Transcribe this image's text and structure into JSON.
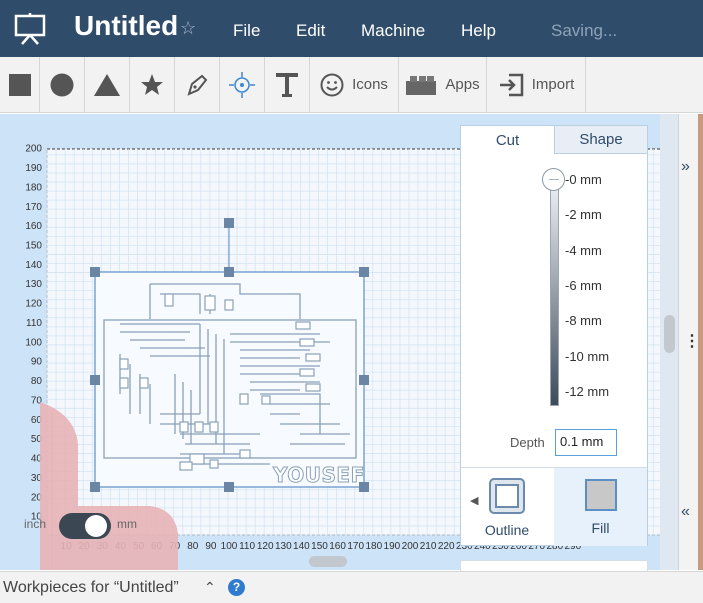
{
  "header": {
    "title": "Untitled",
    "menu": [
      "File",
      "Edit",
      "Machine",
      "Help"
    ],
    "status": "Saving..."
  },
  "toolbar": {
    "icons_label": "Icons",
    "apps_label": "Apps",
    "import_label": "Import"
  },
  "canvas": {
    "y_ticks": [
      "200",
      "190",
      "180",
      "170",
      "160",
      "150",
      "140",
      "130",
      "120",
      "110",
      "100",
      "90",
      "80",
      "70",
      "60",
      "50",
      "40",
      "30",
      "20",
      "10"
    ],
    "x_ticks": [
      "10",
      "20",
      "30",
      "40",
      "50",
      "60",
      "70",
      "80",
      "90",
      "100",
      "110",
      "120",
      "130",
      "140",
      "150",
      "160",
      "170",
      "180",
      "190",
      "200",
      "210",
      "220",
      "230",
      "240",
      "250",
      "260",
      "270",
      "280",
      "290"
    ],
    "design_text": "YOUSEF"
  },
  "units": {
    "left": "inch",
    "right": "mm"
  },
  "panel": {
    "tabs": [
      "Cut",
      "Shape"
    ],
    "depth_ticks": [
      "-0 mm",
      "-2 mm",
      "-4 mm",
      "-6 mm",
      "-8 mm",
      "-10 mm",
      "-12 mm"
    ],
    "depth_label": "Depth",
    "depth_value": "0.1 mm",
    "modes": [
      "Outline",
      "Fill"
    ]
  },
  "bottom": {
    "workpieces_label": "Workpieces for “Untitled”",
    "help_label": "?"
  },
  "colors": {
    "header": "#2f4c6b",
    "canvas": "#cde3f7",
    "accent": "#2f7bcf"
  }
}
